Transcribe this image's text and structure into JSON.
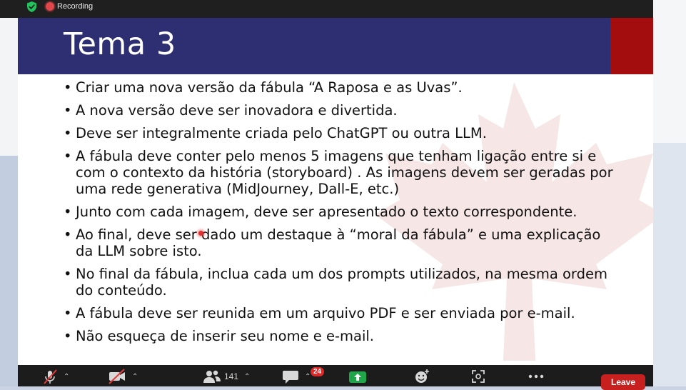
{
  "topbar": {
    "recording_label": "Recording",
    "icons": [
      "security-shield-icon",
      "recording-icon"
    ]
  },
  "slide": {
    "title": "Tema 3",
    "header_color": "#2e2e72",
    "accent_color": "#a30d0d",
    "bullets": [
      "Criar uma nova versão da fábula “A Raposa e as Uvas”.",
      "A nova versão deve ser inovadora e divertida.",
      "Deve ser integralmente criada pelo ChatGPT ou outra LLM.",
      "A fábula deve conter pelo menos 5 imagens que tenham ligação entre si e\ncom o contexto da história (storyboard) . As imagens devem ser geradas por\numa rede generativa (MidJourney, Dall-E, etc.)",
      "Junto com cada imagem, deve ser apresentado o texto correspondente.",
      "Ao final, deve ser dado um destaque à “moral da fábula” e uma explicação\nda LLM sobre isto.",
      "No final da fábula, inclua cada um dos prompts utilizados, na mesma ordem\ndo conteúdo.",
      "A fábula deve ser reunida em um arquivo PDF e ser enviada por e-mail.",
      "Não esqueça de inserir seu nome e e-mail."
    ]
  },
  "toolbar": {
    "participants_count": "141",
    "chat_badge": "24",
    "leave_label": "Leave",
    "icons": [
      "muted-mic-icon",
      "video-off-icon",
      "participants-icon",
      "chat-icon",
      "share-screen-icon",
      "reactions-icon",
      "apps-icon",
      "more-icon"
    ]
  }
}
